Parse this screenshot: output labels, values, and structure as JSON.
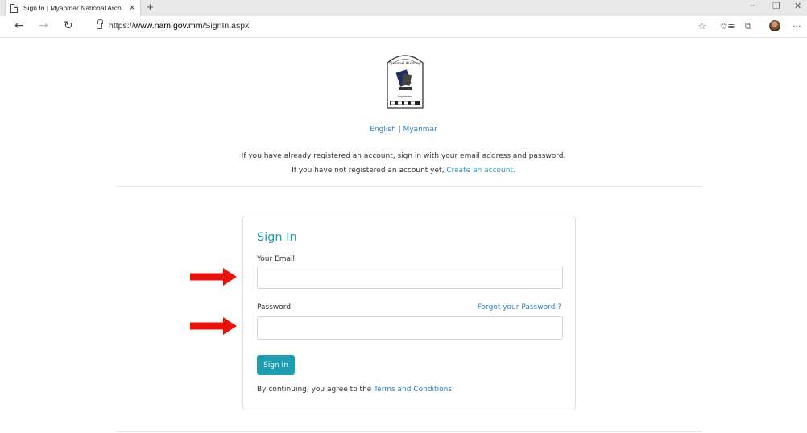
{
  "browser": {
    "tab_title": "Sign In | Myanmar National Archi",
    "tab_close": "×",
    "new_tab": "+",
    "url_prefix": "https://",
    "url_host": "www.nam.gov.mm",
    "url_path": "/SignIn.aspx",
    "window_controls": {
      "minimize": "–",
      "restore": "❐",
      "close": "✕"
    },
    "nav": {
      "back": "←",
      "forward": "→",
      "refresh": "↻"
    },
    "toolbar_icons": [
      "star-icon",
      "favorites-icon",
      "collections-icon",
      "avatar",
      "more-icon"
    ],
    "toolbar_glyphs": {
      "star": "☆",
      "favorites": "✩≡",
      "collections": "⧉",
      "more": "···"
    }
  },
  "header": {
    "logo_text_top": "National Archives",
    "logo_text_bottom": "Department",
    "lang_english": "English",
    "lang_sep": " | ",
    "lang_myanmar": "Myanmar",
    "intro_line1": "If you have already registered an account, sign in with your email address and password.",
    "intro_line2_prefix": "If you have not registered an account yet, ",
    "intro_line2_link": "Create an account."
  },
  "signin": {
    "title": "Sign In",
    "email_label": "Your Email",
    "email_value": "",
    "password_label": "Password",
    "password_value": "",
    "forgot_link": "Forgot your Password ?",
    "submit_label": "Sign In",
    "agree_prefix": "By continuing, you agree to the ",
    "agree_link": "Terms and Conditions",
    "agree_suffix": "."
  },
  "colors": {
    "accent": "#1e9cb2",
    "link": "#2b7fc6",
    "arrow": "#e8120c"
  }
}
